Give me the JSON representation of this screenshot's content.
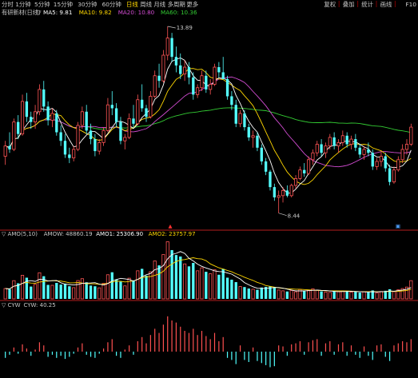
{
  "toolbar": {
    "left_tabs": [
      "分时",
      "1分钟",
      "5分钟",
      "15分钟",
      "30分钟",
      "60分钟",
      "日线",
      "周线",
      "月线",
      "多周期",
      "更多"
    ],
    "active_tab_index": 6,
    "right_tabs": [
      "复权",
      "叠加",
      "统计",
      "画线",
      "F10"
    ],
    "colors": {
      "bg": "#000000",
      "text": "#c8c8c8",
      "active": "#ffd700",
      "sep": "#7a0000"
    }
  },
  "colors": {
    "background": "#000000",
    "up": "#ff5555",
    "down": "#54ffff",
    "ma5": "#ffffff",
    "ma10": "#ffd700",
    "ma20": "#d24cd2",
    "ma60": "#33cc33",
    "amo1": "#ffffff",
    "amo2": "#ffd700",
    "divider": "#b41e1e",
    "cyw_pos": "#ff5050",
    "cyw_neg": "#50ffff"
  },
  "price_panel": {
    "title": "有研新材(日线)",
    "indicator_prefix": "▽",
    "ma_legend": [
      {
        "label": "MA5: 9.81",
        "color": "#ffffff"
      },
      {
        "label": "MA10: 9.82",
        "color": "#ffd700"
      },
      {
        "label": "MA20: 10.80",
        "color": "#d24cd2"
      },
      {
        "label": "MA60: 10.36",
        "color": "#33cc33"
      }
    ],
    "high_annotation": "13.89",
    "low_annotation": "8.44",
    "badge_left": "▲",
    "badge_right": "▣"
  },
  "amo_panel": {
    "legend": [
      {
        "label": "▽ AMO(5,10)",
        "color": "#c8c8c8"
      },
      {
        "label": "AMOW: 48860.19",
        "color": "#c8c8c8"
      },
      {
        "label": "AMO1: 25306.90",
        "color": "#ffffff"
      },
      {
        "label": "AMO2: 23757.97",
        "color": "#ffd700"
      }
    ]
  },
  "cyw_panel": {
    "legend": [
      {
        "label": "▽ CYW",
        "color": "#c8c8c8"
      },
      {
        "label": "CYW: 40.25",
        "color": "#c8c8c8"
      }
    ]
  },
  "chart_data": {
    "type": "candlestick",
    "series_count": 96,
    "price_range": [
      8.2,
      14.1
    ],
    "candles_ohlc": [
      [
        10.1,
        10.55,
        9.85,
        10.4
      ],
      [
        10.4,
        10.8,
        10.2,
        10.3
      ],
      [
        10.3,
        11.2,
        10.25,
        11.1
      ],
      [
        11.1,
        11.3,
        10.6,
        10.75
      ],
      [
        10.75,
        11.9,
        10.7,
        11.7
      ],
      [
        11.7,
        11.95,
        11.1,
        11.25
      ],
      [
        11.25,
        11.4,
        10.9,
        11.1
      ],
      [
        11.1,
        11.6,
        10.9,
        11.4
      ],
      [
        11.4,
        12.2,
        11.3,
        12.05
      ],
      [
        12.05,
        12.3,
        11.4,
        11.55
      ],
      [
        11.55,
        11.7,
        11.0,
        11.15
      ],
      [
        11.15,
        11.5,
        10.95,
        11.35
      ],
      [
        11.35,
        11.45,
        10.7,
        10.8
      ],
      [
        10.8,
        11.0,
        10.4,
        10.55
      ],
      [
        10.55,
        10.75,
        10.05,
        10.15
      ],
      [
        10.15,
        10.35,
        9.9,
        10.05
      ],
      [
        10.05,
        10.4,
        9.95,
        10.3
      ],
      [
        10.3,
        11.1,
        10.25,
        11.0
      ],
      [
        11.0,
        11.55,
        10.9,
        11.4
      ],
      [
        11.4,
        11.6,
        10.75,
        10.85
      ],
      [
        10.85,
        11.05,
        10.45,
        10.6
      ],
      [
        10.6,
        10.75,
        10.1,
        10.25
      ],
      [
        10.25,
        10.6,
        10.15,
        10.5
      ],
      [
        10.5,
        10.95,
        10.4,
        10.85
      ],
      [
        10.85,
        11.8,
        10.8,
        11.6
      ],
      [
        11.6,
        12.0,
        11.3,
        11.5
      ],
      [
        11.5,
        11.65,
        10.95,
        11.1
      ],
      [
        11.1,
        11.25,
        10.45,
        10.55
      ],
      [
        10.55,
        10.75,
        10.3,
        10.65
      ],
      [
        10.65,
        11.35,
        10.6,
        11.2
      ],
      [
        11.2,
        11.6,
        10.95,
        11.05
      ],
      [
        11.05,
        11.9,
        11.0,
        11.75
      ],
      [
        11.75,
        12.2,
        11.4,
        11.5
      ],
      [
        11.5,
        11.6,
        11.1,
        11.25
      ],
      [
        11.25,
        12.0,
        11.2,
        11.85
      ],
      [
        11.85,
        12.6,
        11.8,
        12.45
      ],
      [
        12.45,
        12.8,
        12.1,
        12.3
      ],
      [
        12.3,
        13.2,
        12.25,
        13.05
      ],
      [
        13.05,
        13.89,
        12.9,
        13.55
      ],
      [
        13.55,
        13.7,
        12.85,
        13.0
      ],
      [
        13.0,
        13.3,
        12.55,
        12.75
      ],
      [
        12.75,
        13.1,
        12.35,
        12.5
      ],
      [
        12.5,
        12.9,
        12.3,
        12.7
      ],
      [
        12.7,
        12.85,
        12.2,
        12.4
      ],
      [
        12.4,
        12.55,
        11.75,
        11.9
      ],
      [
        11.9,
        12.2,
        11.8,
        12.1
      ],
      [
        12.1,
        12.6,
        12.0,
        12.45
      ],
      [
        12.45,
        12.6,
        11.95,
        12.05
      ],
      [
        12.05,
        12.35,
        11.9,
        12.2
      ],
      [
        12.2,
        12.8,
        12.15,
        12.7
      ],
      [
        12.7,
        12.85,
        12.4,
        12.55
      ],
      [
        12.55,
        13.0,
        12.45,
        12.35
      ],
      [
        12.35,
        12.45,
        11.75,
        11.85
      ],
      [
        11.85,
        12.0,
        11.45,
        11.6
      ],
      [
        11.6,
        11.75,
        10.95,
        11.05
      ],
      [
        11.05,
        11.45,
        10.95,
        11.35
      ],
      [
        11.35,
        11.45,
        10.85,
        10.95
      ],
      [
        10.95,
        11.05,
        10.55,
        10.65
      ],
      [
        10.65,
        10.85,
        10.35,
        10.7
      ],
      [
        10.7,
        10.8,
        10.25,
        10.35
      ],
      [
        10.35,
        10.45,
        9.85,
        9.95
      ],
      [
        9.95,
        10.05,
        9.55,
        9.65
      ],
      [
        9.65,
        9.7,
        9.1,
        9.2
      ],
      [
        9.2,
        9.3,
        8.8,
        8.9
      ],
      [
        8.9,
        9.1,
        8.44,
        8.95
      ],
      [
        8.95,
        9.2,
        8.75,
        9.1
      ],
      [
        9.1,
        9.25,
        8.9,
        8.95
      ],
      [
        8.95,
        9.3,
        8.9,
        9.25
      ],
      [
        9.25,
        9.55,
        9.15,
        9.45
      ],
      [
        9.45,
        9.8,
        9.4,
        9.7
      ],
      [
        9.7,
        9.9,
        9.5,
        9.6
      ],
      [
        9.6,
        10.1,
        9.55,
        10.0
      ],
      [
        10.0,
        10.3,
        9.85,
        10.2
      ],
      [
        10.2,
        10.55,
        10.1,
        10.45
      ],
      [
        10.45,
        10.6,
        10.1,
        10.2
      ],
      [
        10.2,
        10.5,
        10.05,
        10.4
      ],
      [
        10.4,
        10.75,
        10.3,
        10.65
      ],
      [
        10.65,
        10.8,
        10.3,
        10.4
      ],
      [
        10.4,
        10.6,
        10.2,
        10.5
      ],
      [
        10.5,
        10.85,
        10.4,
        10.7
      ],
      [
        10.7,
        10.8,
        10.35,
        10.45
      ],
      [
        10.45,
        10.7,
        10.3,
        10.6
      ],
      [
        10.6,
        10.75,
        10.25,
        10.35
      ],
      [
        10.35,
        10.45,
        10.05,
        10.15
      ],
      [
        10.15,
        10.4,
        10.0,
        10.3
      ],
      [
        10.3,
        10.5,
        10.1,
        10.2
      ],
      [
        10.2,
        10.3,
        9.7,
        9.8
      ],
      [
        9.8,
        10.05,
        9.7,
        9.95
      ],
      [
        9.95,
        10.25,
        9.8,
        10.1
      ],
      [
        10.1,
        10.2,
        9.65,
        9.75
      ],
      [
        9.75,
        9.85,
        9.25,
        9.35
      ],
      [
        9.35,
        9.8,
        9.3,
        9.7
      ],
      [
        9.7,
        10.1,
        9.65,
        10.0
      ],
      [
        10.0,
        10.45,
        9.9,
        10.3
      ],
      [
        10.3,
        10.6,
        10.15,
        10.45
      ],
      [
        10.45,
        11.05,
        10.4,
        10.95
      ]
    ],
    "amo_values": [
      10500,
      9800,
      18500,
      15800,
      24000,
      21500,
      12500,
      14800,
      26500,
      23000,
      14200,
      13800,
      16200,
      14500,
      15500,
      12800,
      11400,
      18600,
      20500,
      16800,
      13500,
      12800,
      11200,
      15800,
      24500,
      27000,
      19500,
      17500,
      13200,
      21000,
      18800,
      28500,
      30500,
      23500,
      27500,
      38500,
      34000,
      45000,
      58000,
      49500,
      44500,
      43000,
      35500,
      33000,
      36500,
      28500,
      31500,
      27500,
      25500,
      29500,
      24500,
      30500,
      21500,
      19500,
      17000,
      12500,
      12000,
      10500,
      9800,
      9200,
      11500,
      12200,
      13000,
      11800,
      9000,
      8200,
      7500,
      8500,
      7200,
      9500,
      7800,
      8800,
      10200,
      8900,
      7600,
      7000,
      6600,
      8200,
      7300,
      8000,
      7700,
      6900,
      7600,
      6400,
      7200,
      6800,
      8600,
      6200,
      7500,
      8200,
      9800,
      7400,
      9200,
      10500,
      12000,
      18500
    ],
    "amo_max": 60000,
    "cyw_values": [
      -6,
      -3,
      4,
      -2,
      7,
      3,
      -4,
      2,
      9,
      6,
      -5,
      -3,
      -6,
      -4,
      -7,
      -5,
      -2,
      4,
      8,
      -3,
      -5,
      -6,
      -2,
      3,
      9,
      12,
      -4,
      -6,
      2,
      6,
      -3,
      10,
      14,
      8,
      16,
      22,
      18,
      26,
      34,
      30,
      28,
      24,
      20,
      18,
      22,
      16,
      20,
      15,
      12,
      18,
      10,
      14,
      -6,
      -8,
      -12,
      6,
      -8,
      -10,
      4,
      -9,
      -11,
      -13,
      -15,
      -14,
      6,
      5,
      -4,
      7,
      8,
      10,
      -3,
      9,
      11,
      12,
      -4,
      8,
      10,
      -3,
      7,
      9,
      -4,
      6,
      -3,
      -6,
      5,
      -4,
      -8,
      6,
      7,
      -5,
      -9,
      6,
      8,
      10,
      9,
      12
    ],
    "cyw_range": [
      -20,
      40
    ]
  }
}
